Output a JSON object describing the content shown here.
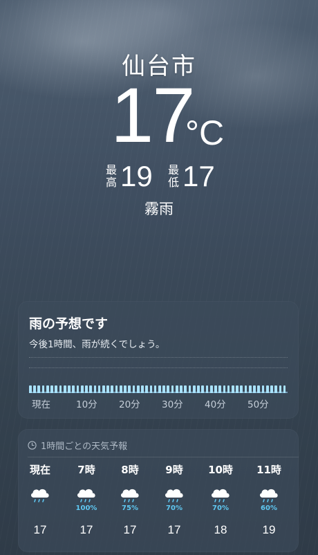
{
  "location": {
    "city": "仙台市"
  },
  "current": {
    "temperature": "17",
    "unit": "°C",
    "high_label": "最高",
    "high": "19",
    "low_label": "最低",
    "low": "17",
    "condition": "霧雨"
  },
  "rain_forecast": {
    "title": "雨の予想です",
    "subtitle": "今後1時間、雨が続くでしょう。",
    "axis_labels": [
      "現在",
      "10分",
      "20分",
      "30分",
      "40分",
      "50分"
    ],
    "intensity_level": 0.3,
    "color": "#a9e2fb"
  },
  "hourly": {
    "header": "1時間ごとの天気予報",
    "items": [
      {
        "time": "現在",
        "icon": "rain-cloud-icon",
        "probability": "",
        "temp": "17"
      },
      {
        "time": "7時",
        "icon": "rain-cloud-icon",
        "probability": "100%",
        "temp": "17"
      },
      {
        "time": "8時",
        "icon": "rain-cloud-icon",
        "probability": "75%",
        "temp": "17"
      },
      {
        "time": "9時",
        "icon": "rain-cloud-icon",
        "probability": "70%",
        "temp": "17"
      },
      {
        "time": "10時",
        "icon": "rain-cloud-icon",
        "probability": "70%",
        "temp": "18"
      },
      {
        "time": "11時",
        "icon": "rain-cloud-icon",
        "probability": "60%",
        "temp": "19"
      }
    ],
    "probability_color": "#5fc8f2"
  }
}
